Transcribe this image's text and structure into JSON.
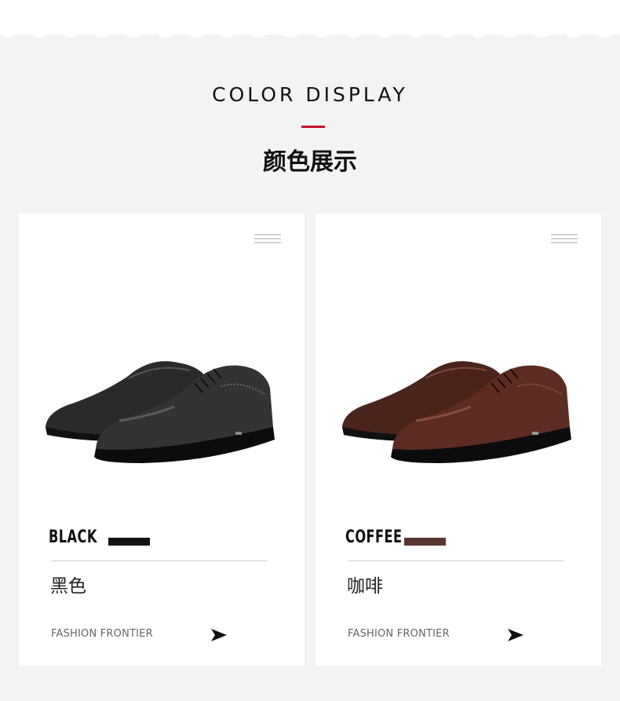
{
  "header": {
    "title_en": "COLOR DISPLAY",
    "title_cn": "颜色展示"
  },
  "colors": {
    "accent": "#c8102e",
    "background": "#f3f3f3",
    "card": "#ffffff"
  },
  "cards": [
    {
      "name": "BLACK",
      "name_cn": "黑色",
      "swatch_color": "#111111",
      "tagline": "FASHION FRONTIER",
      "menu_icon": "hamburger-icon",
      "arrow_icon": "arrow-right-icon"
    },
    {
      "name": "COFFEE",
      "name_cn": "咖啡",
      "swatch_color": "#5a3530",
      "tagline": "FASHION FRONTIER",
      "menu_icon": "hamburger-icon",
      "arrow_icon": "arrow-right-icon"
    }
  ]
}
